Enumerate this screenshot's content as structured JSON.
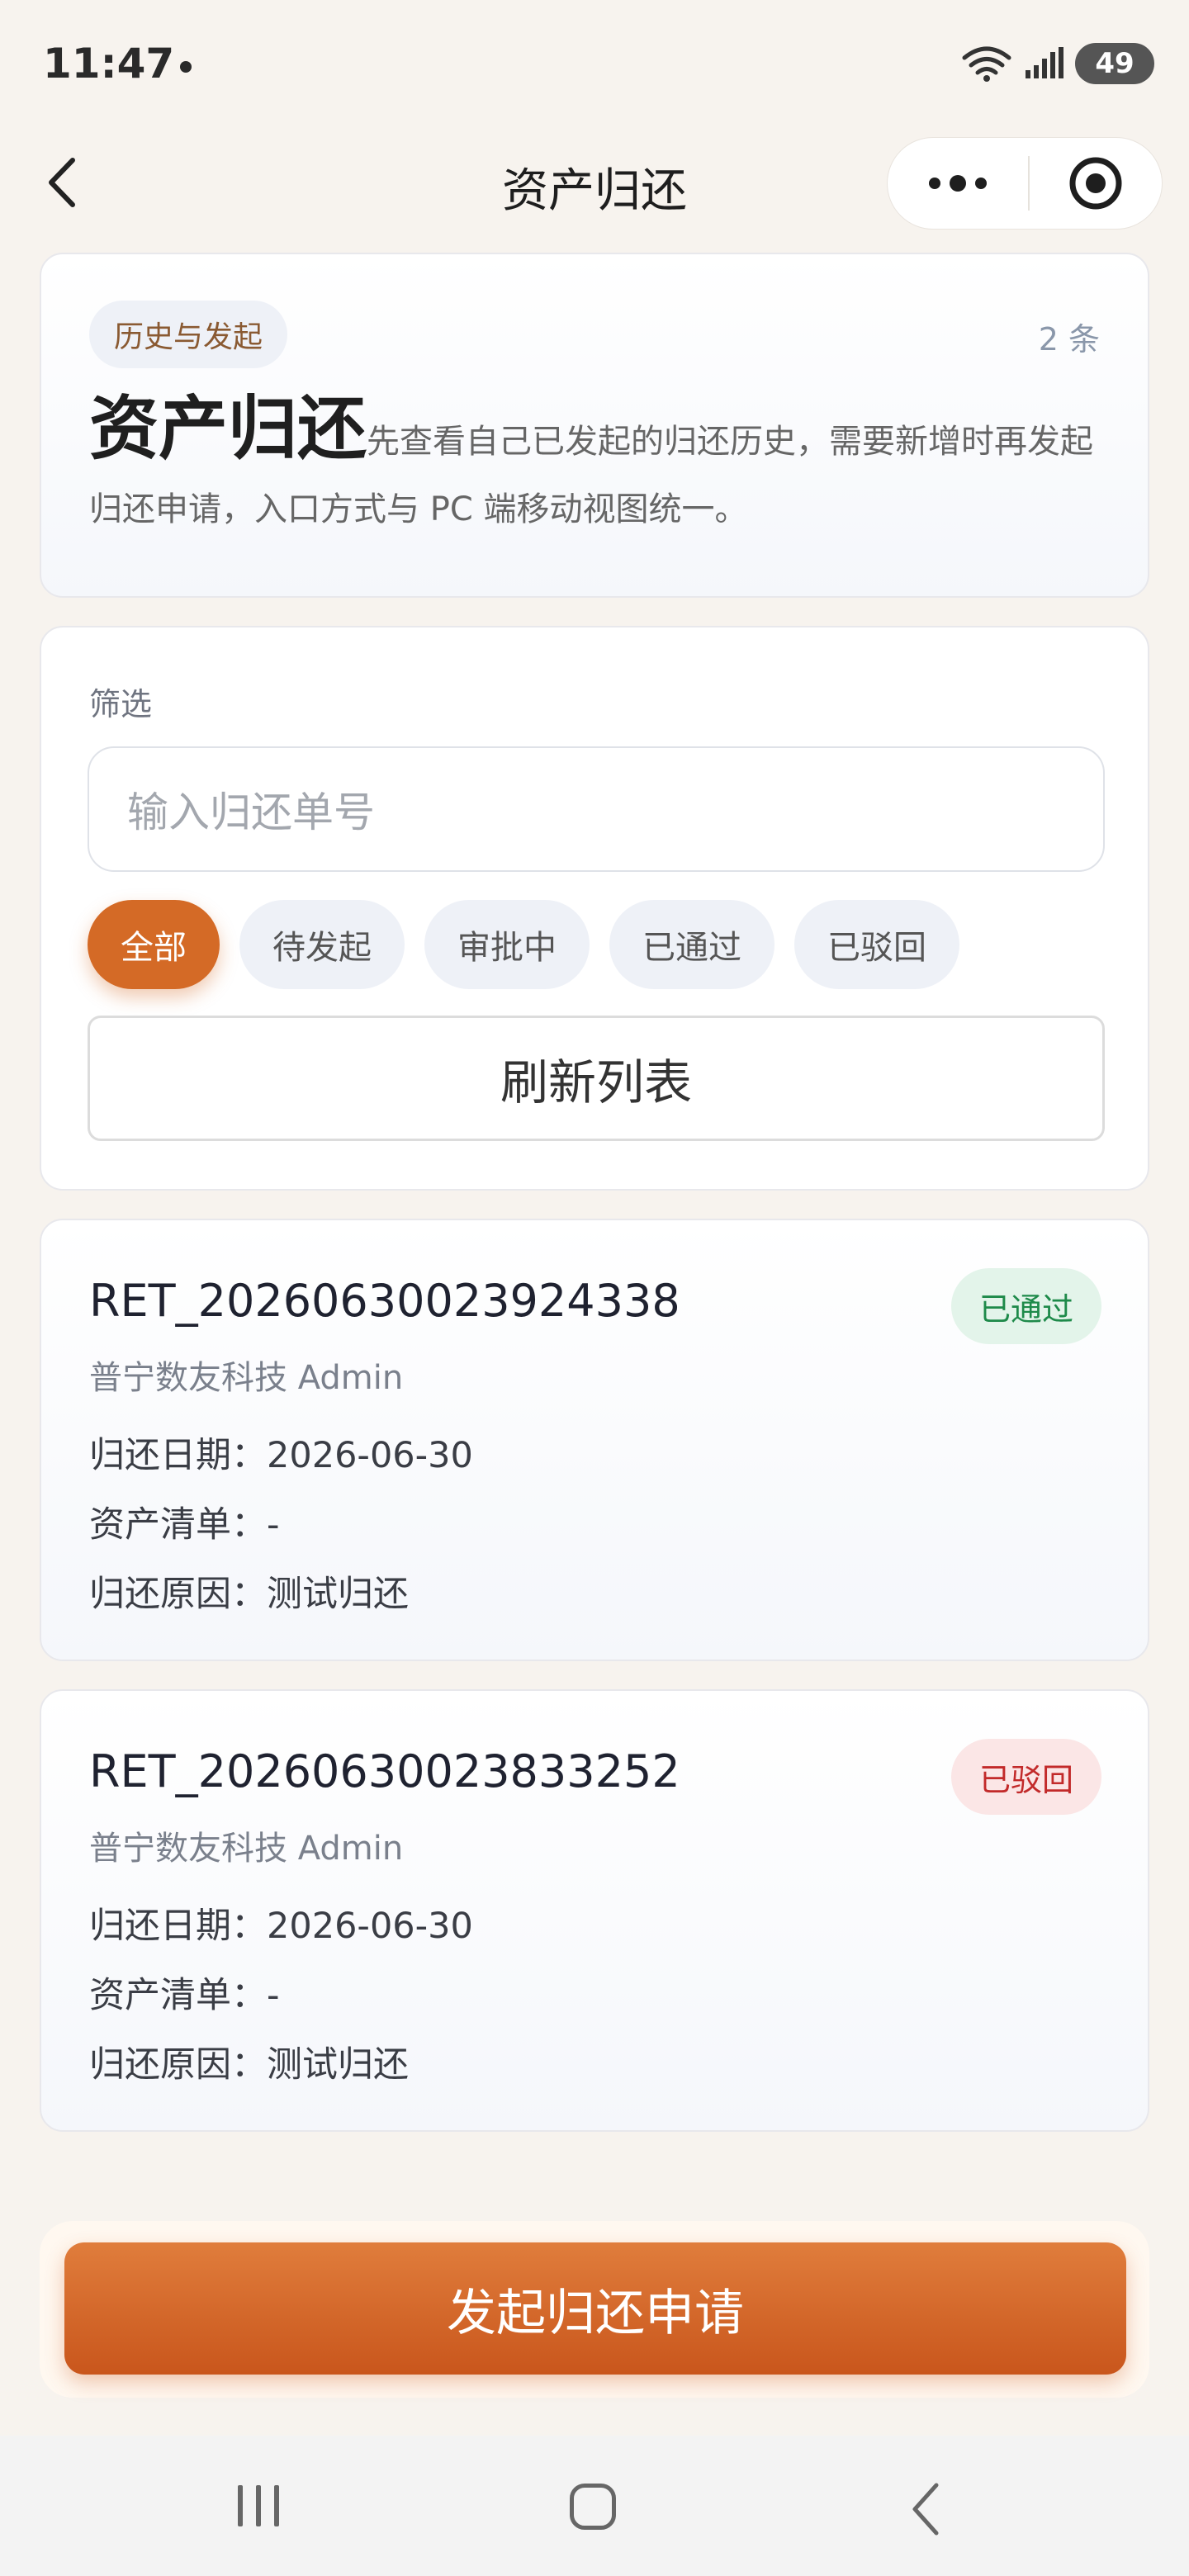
{
  "status_bar": {
    "time": "11:47",
    "battery": "49"
  },
  "nav": {
    "title": "资产归还"
  },
  "intro_card": {
    "tag": "历史与发起",
    "count": "2 条",
    "heading": "资产归还",
    "description": "先查看自己已发起的归还历史，需要新增时再发起归还申请，入口方式与 PC 端移动视图统一。"
  },
  "filter_card": {
    "label": "筛选",
    "search_placeholder": "输入归还单号",
    "chips": [
      "全部",
      "待发起",
      "审批中",
      "已通过",
      "已驳回"
    ],
    "active_chip": "全部",
    "refresh_label": "刷新列表"
  },
  "records": [
    {
      "id": "RET_20260630023924338",
      "company": "普宁数友科技 Admin",
      "status": "已通过",
      "status_color": "#1e8a4a",
      "date_line": "归还日期：2026-06-30",
      "assets_line": "资产清单：-",
      "reason_line": "归还原因：测试归还"
    },
    {
      "id": "RET_20260630023833252",
      "company": "普宁数友科技 Admin",
      "status": "已驳回",
      "status_color": "#c22a2a",
      "date_line": "归还日期：2026-06-30",
      "assets_line": "资产清单：-",
      "reason_line": "归还原因：测试归还"
    }
  ],
  "action": {
    "submit_label": "发起归还申请"
  },
  "colors": {
    "accent": "#d46a26",
    "success": "#1e8a4a",
    "danger": "#c22a2a"
  }
}
